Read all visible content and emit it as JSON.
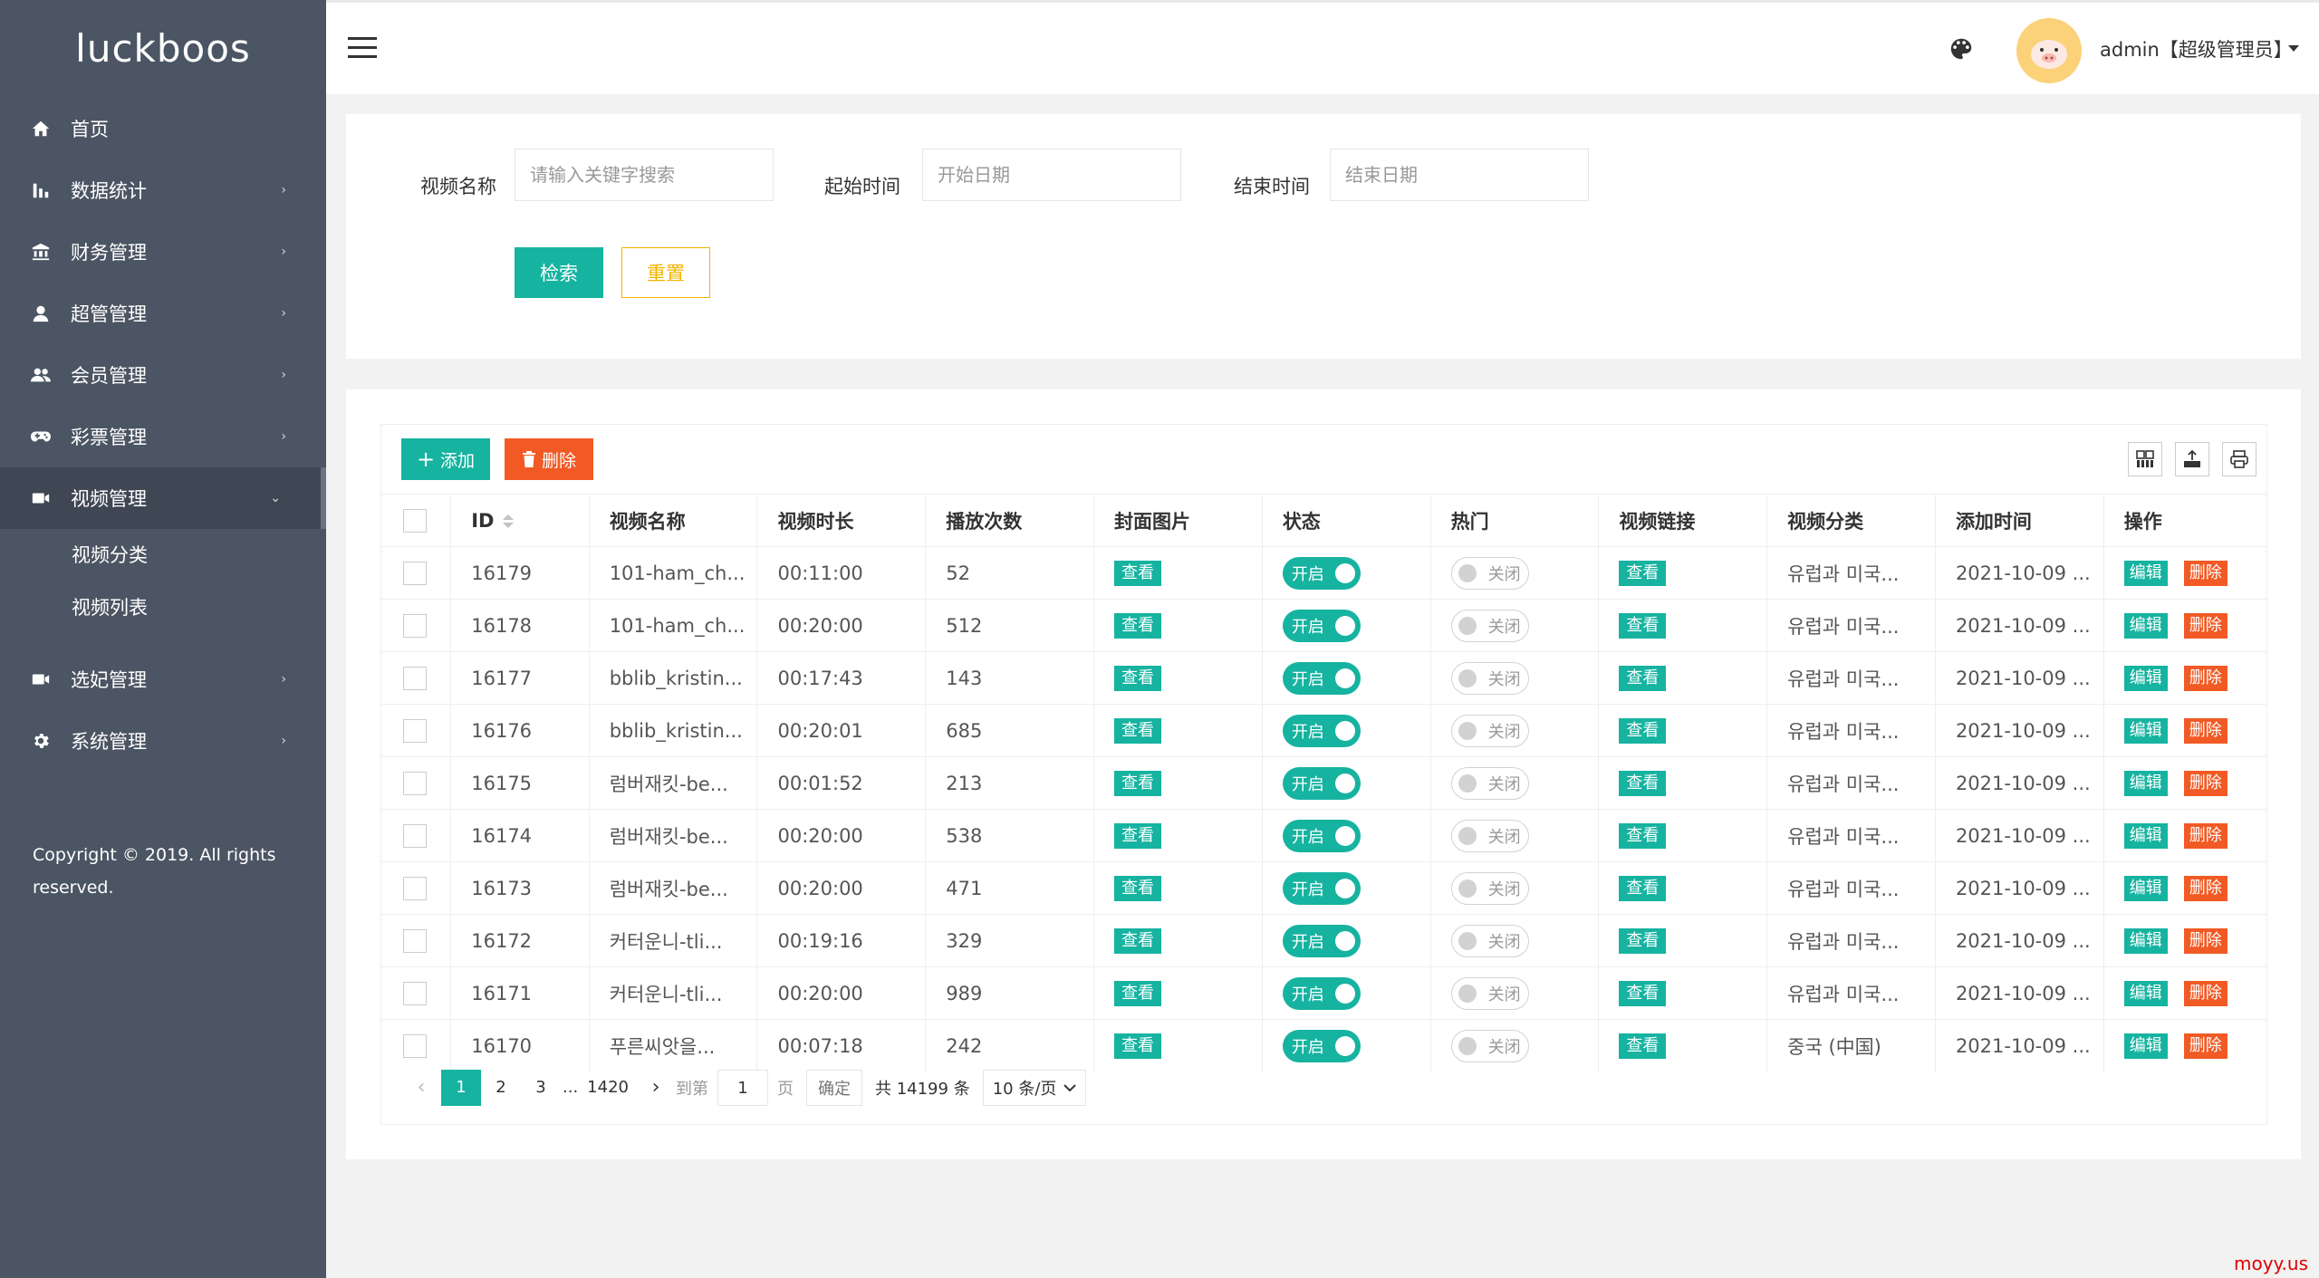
{
  "sidebar": {
    "logo": "luckboos",
    "items": [
      {
        "label": "首页",
        "icon": "home-icon",
        "has_arrow": false
      },
      {
        "label": "数据统计",
        "icon": "bar-chart-icon",
        "has_arrow": true
      },
      {
        "label": "财务管理",
        "icon": "bank-icon",
        "has_arrow": true
      },
      {
        "label": "超管管理",
        "icon": "user-icon",
        "has_arrow": true
      },
      {
        "label": "会员管理",
        "icon": "users-icon",
        "has_arrow": true
      },
      {
        "label": "彩票管理",
        "icon": "gamepad-icon",
        "has_arrow": true
      },
      {
        "label": "视频管理",
        "icon": "video-icon",
        "has_arrow": true,
        "open": true
      },
      {
        "label": "选妃管理",
        "icon": "video-icon",
        "has_arrow": true
      },
      {
        "label": "系统管理",
        "icon": "gear-icon",
        "has_arrow": true
      }
    ],
    "sub_items": [
      "视频分类",
      "视频列表"
    ],
    "copyright": "Copyright © 2019. All rights reserved."
  },
  "header": {
    "admin_label": "admin【超级管理员】"
  },
  "search": {
    "name_label": "视频名称",
    "name_placeholder": "请输入关键字搜索",
    "start_label": "起始时间",
    "start_placeholder": "开始日期",
    "end_label": "结束时间",
    "end_placeholder": "结束日期",
    "search_button": "检索",
    "reset_button": "重置"
  },
  "toolbar": {
    "add_label": "添加",
    "delete_label": "删除"
  },
  "table": {
    "columns": [
      "ID",
      "视频名称",
      "视频时长",
      "播放次数",
      "封面图片",
      "状态",
      "热门",
      "视频链接",
      "视频分类",
      "添加时间",
      "操作"
    ],
    "view_label": "查看",
    "status_on_label": "开启",
    "hot_off_label": "关闭",
    "edit_label": "编辑",
    "delete_label": "删除",
    "rows": [
      {
        "id": "16179",
        "name": "101-ham_ch...",
        "duration": "00:11:00",
        "plays": "52",
        "category": "유럽과 미국...",
        "added": "2021-10-09 ..."
      },
      {
        "id": "16178",
        "name": "101-ham_ch...",
        "duration": "00:20:00",
        "plays": "512",
        "category": "유럽과 미국...",
        "added": "2021-10-09 ..."
      },
      {
        "id": "16177",
        "name": "bblib_kristin...",
        "duration": "00:17:43",
        "plays": "143",
        "category": "유럽과 미국...",
        "added": "2021-10-09 ..."
      },
      {
        "id": "16176",
        "name": "bblib_kristin...",
        "duration": "00:20:01",
        "plays": "685",
        "category": "유럽과 미국...",
        "added": "2021-10-09 ..."
      },
      {
        "id": "16175",
        "name": "럼버재킷-be...",
        "duration": "00:01:52",
        "plays": "213",
        "category": "유럽과 미국...",
        "added": "2021-10-09 ..."
      },
      {
        "id": "16174",
        "name": "럼버재킷-be...",
        "duration": "00:20:00",
        "plays": "538",
        "category": "유럽과 미국...",
        "added": "2021-10-09 ..."
      },
      {
        "id": "16173",
        "name": "럼버재킷-be...",
        "duration": "00:20:00",
        "plays": "471",
        "category": "유럽과 미국...",
        "added": "2021-10-09 ..."
      },
      {
        "id": "16172",
        "name": "커터운니-tli...",
        "duration": "00:19:16",
        "plays": "329",
        "category": "유럽과 미국...",
        "added": "2021-10-09 ..."
      },
      {
        "id": "16171",
        "name": "커터운니-tli...",
        "duration": "00:20:00",
        "plays": "989",
        "category": "유럽과 미국...",
        "added": "2021-10-09 ..."
      },
      {
        "id": "16170",
        "name": "푸른씨앗을...",
        "duration": "00:07:18",
        "plays": "242",
        "category": "중국 (中国)",
        "added": "2021-10-09 ..."
      }
    ]
  },
  "pagination": {
    "pages": [
      "1",
      "2",
      "3"
    ],
    "ellipsis": "...",
    "last_page": "1420",
    "goto_label": "到第",
    "goto_value": "1",
    "page_unit": "页",
    "confirm_label": "确定",
    "total_label": "共 14199 条",
    "page_size_label": "10 条/页"
  },
  "watermark": "moyy.us",
  "colors": {
    "sidebar_bg": "#4b5563",
    "primary": "#16b3a0",
    "danger": "#f15a24",
    "warning": "#f3b400"
  }
}
